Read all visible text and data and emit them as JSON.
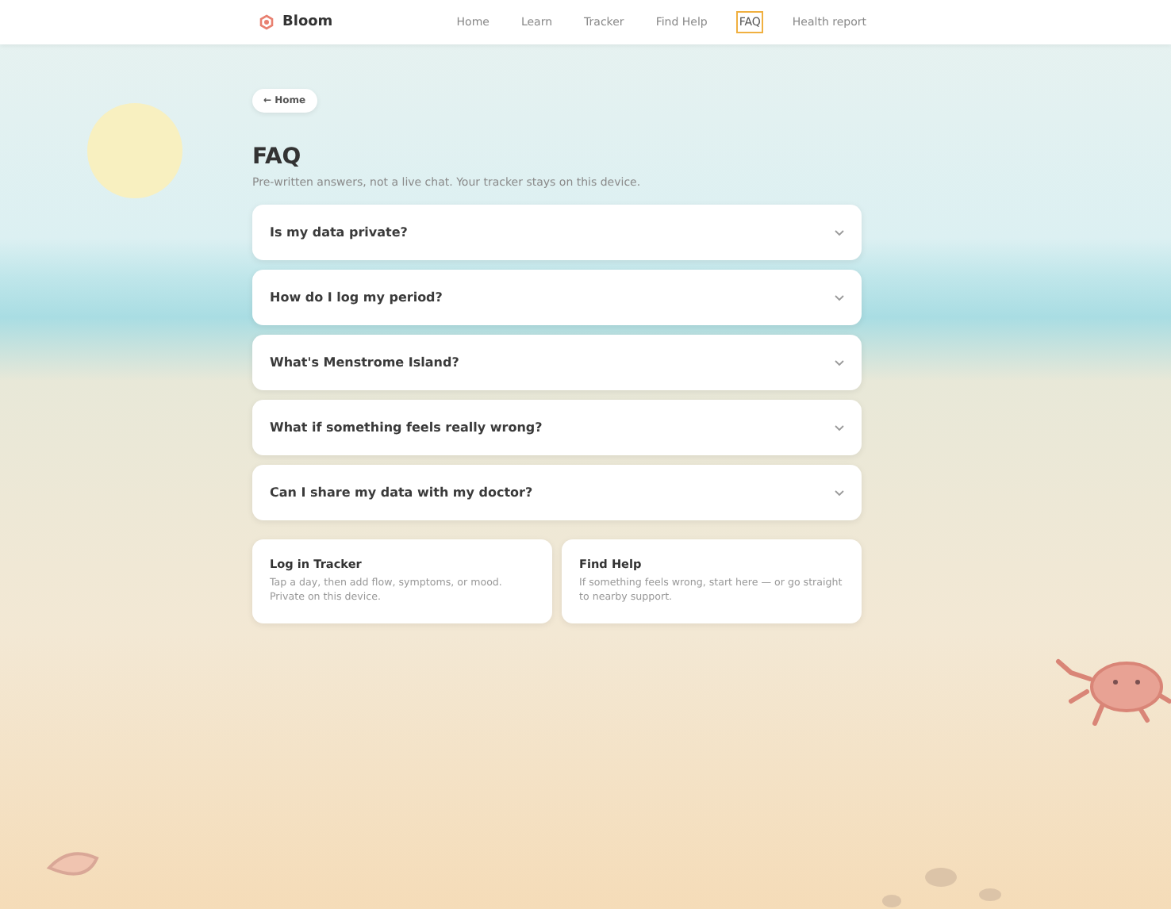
{
  "brand": {
    "name": "Bloom"
  },
  "nav": [
    {
      "label": "Home",
      "selected": false
    },
    {
      "label": "Learn",
      "selected": false
    },
    {
      "label": "Tracker",
      "selected": false
    },
    {
      "label": "Find Help",
      "selected": false
    },
    {
      "label": "FAQ",
      "selected": true
    },
    {
      "label": "Health report",
      "selected": false
    }
  ],
  "back_button": {
    "label": "← Home"
  },
  "title": "FAQ",
  "subtitle": "Pre-written answers, not a live chat. Your tracker stays on this device.",
  "faq": [
    {
      "question": "Is my data private?",
      "expanded": false
    },
    {
      "question": "How do I log my period?",
      "expanded": false
    },
    {
      "question": "What's Menstrome Island?",
      "expanded": false
    },
    {
      "question": "What if something feels really wrong?",
      "expanded": false
    },
    {
      "question": "Can I share my data with my doctor?",
      "expanded": false
    }
  ],
  "cards": [
    {
      "title": "Log in Tracker",
      "text": "Tap a day, then add flow, symptoms, or mood. Private on this device."
    },
    {
      "title": "Find Help",
      "text": "If something feels wrong, start here — or go straight to nearby support."
    }
  ]
}
